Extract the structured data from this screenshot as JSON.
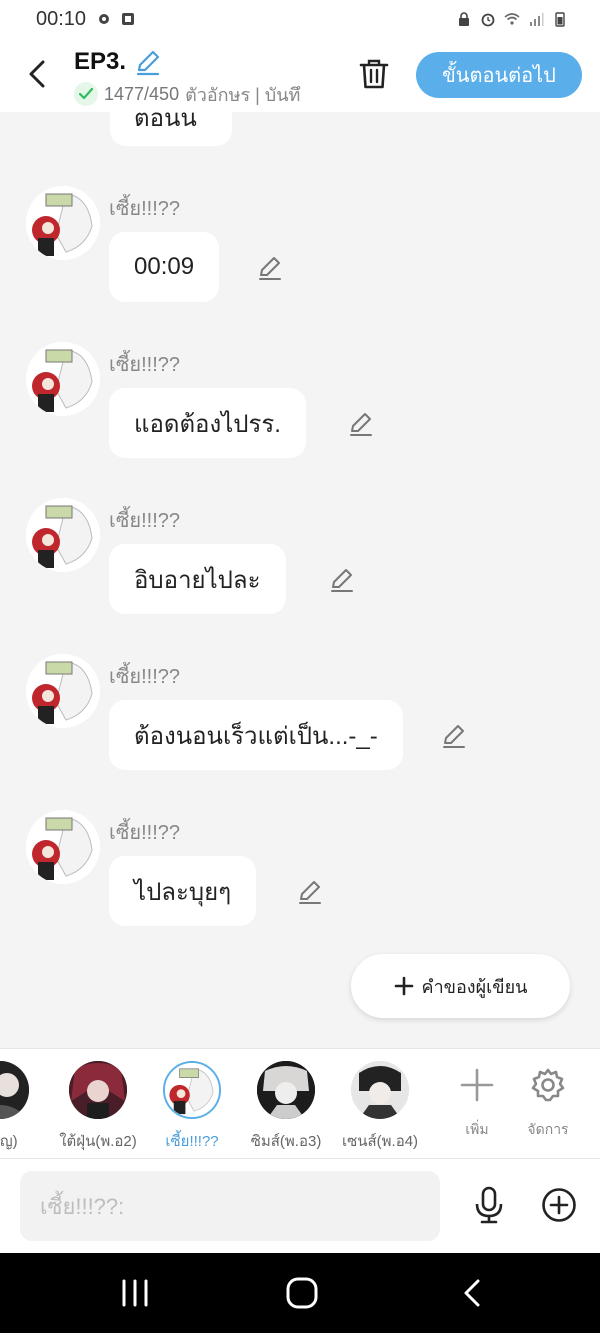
{
  "status_bar": {
    "time": "00:10"
  },
  "header": {
    "title": "EP3.",
    "char_count": "1477/450",
    "count_suffix": "ตัวอักษร | บันทึ",
    "next_label": "ขั้นตอนต่อไป"
  },
  "chat": {
    "partial_bubble": "ตอนนี้",
    "messages": [
      {
        "sender": "เซี้ย!!!??",
        "text": "00:09"
      },
      {
        "sender": "เซี้ย!!!??",
        "text": "แอดต้องไปรร."
      },
      {
        "sender": "เซี้ย!!!??",
        "text": "อิบอายไปละ"
      },
      {
        "sender": "เซี้ย!!!??",
        "text": "ต้องนอนเร็วแต่เป็น...-_-"
      },
      {
        "sender": "เซี้ย!!!??",
        "text": "ไปละบุยๆ"
      }
    ],
    "writer_note_label": "คำของผู้เขียน"
  },
  "characters": [
    {
      "label": "า.(ญ)",
      "selected": false
    },
    {
      "label": "ใต้ฝุ่น(พ.อ2)",
      "selected": false
    },
    {
      "label": "เซี้ย!!!??",
      "selected": true
    },
    {
      "label": "ซิมส์(พ.อ3)",
      "selected": false
    },
    {
      "label": "เซนส์(พ.อ4)",
      "selected": false
    }
  ],
  "actions": {
    "add_label": "เพิ่ม",
    "manage_label": "จัดการ"
  },
  "input": {
    "placeholder": "เซี้ย!!!??:"
  },
  "colors": {
    "accent": "#5aaeea",
    "background": "#f4f4f4",
    "bubble": "#ffffff",
    "nav": "#000000"
  }
}
